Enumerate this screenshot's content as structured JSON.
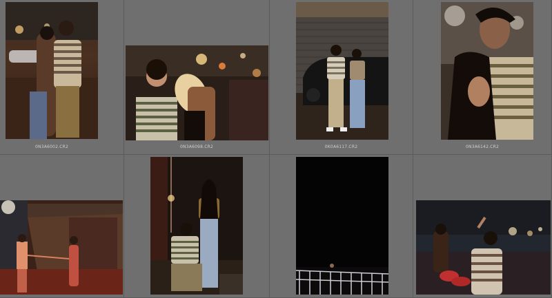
{
  "files": [
    {
      "name": "0N3A6002.CR2"
    },
    {
      "name": "0N3A6098.CR2"
    },
    {
      "name": "0K0A6117.CR2"
    },
    {
      "name": "0N3A6142.CR2"
    },
    {
      "name": ""
    },
    {
      "name": ""
    },
    {
      "name": ""
    },
    {
      "name": ""
    }
  ],
  "colors": {
    "background": "#6b6b6b",
    "cell": "#6f6f6f",
    "filename_text": "#cfcfcf"
  }
}
